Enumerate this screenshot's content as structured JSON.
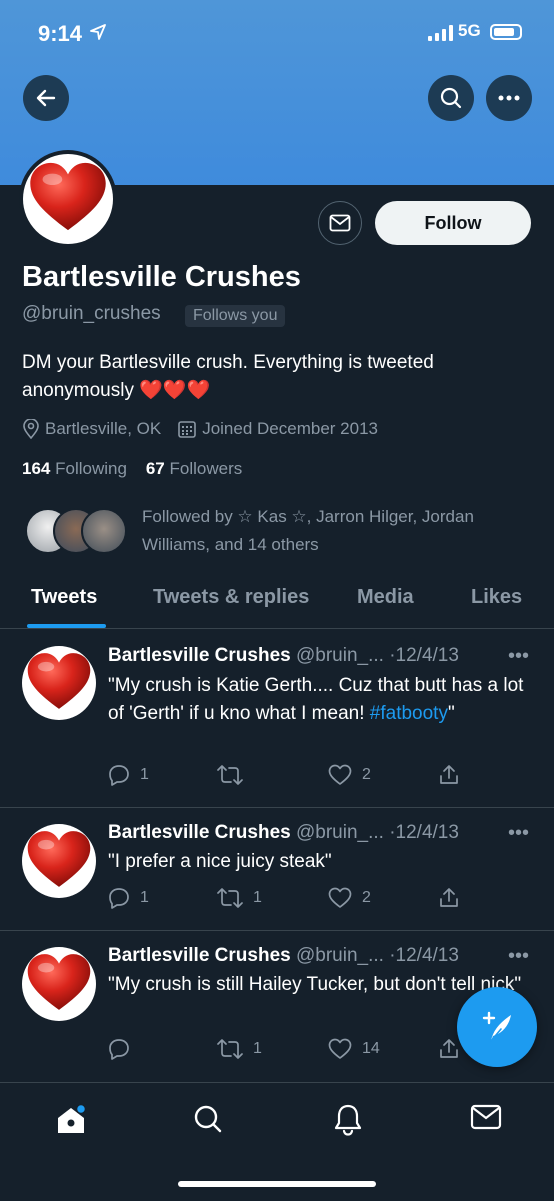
{
  "status": {
    "time": "9:14",
    "network": "5G"
  },
  "profile": {
    "name": "Bartlesville Crushes",
    "handle": "@bruin_crushes",
    "follows_you": "Follows you",
    "bio": "DM your Bartlesville crush. Everything is tweeted anonymously ❤️❤️❤️",
    "location": "Bartlesville, OK",
    "joined": "Joined December 2013",
    "following_count": "164",
    "following_label": "Following",
    "followers_count": "67",
    "followers_label": "Followers",
    "followed_by": "Followed by ☆ Kas ☆, Jarron Hilger, Jordan Williams, and 14 others",
    "follow_button": "Follow"
  },
  "tabs": [
    {
      "label": "Tweets",
      "active": true
    },
    {
      "label": "Tweets & replies"
    },
    {
      "label": "Media"
    },
    {
      "label": "Likes"
    }
  ],
  "tweets": [
    {
      "name": "Bartlesville Crushes",
      "handle": "@bruin_...",
      "date": "·12/4/13",
      "text": "\"My crush is Katie Gerth.... Cuz that butt has a lot of 'Gerth' if u kno what I mean!",
      "hashtag": "#fatbooty",
      "text_end": "\"",
      "replies": "1",
      "retweets": "",
      "likes": "2"
    },
    {
      "name": "Bartlesville Crushes",
      "handle": "@bruin_...",
      "date": "·12/4/13",
      "text": "\"I prefer a nice juicy steak\"",
      "replies": "1",
      "retweets": "1",
      "likes": "2"
    },
    {
      "name": "Bartlesville Crushes",
      "handle": "@bruin_...",
      "date": "·12/4/13",
      "text": "\"My crush is still Hailey Tucker, but don't tell nick\"",
      "replies": "",
      "retweets": "1",
      "likes": "14"
    }
  ],
  "more_glyph": "•••",
  "icons": {
    "back": "arrow-left-icon",
    "search": "search-icon",
    "more": "more-icon",
    "message": "envelope-icon",
    "compose": "compose-icon",
    "home": "home-icon",
    "notifications": "bell-icon"
  },
  "colors": {
    "accent": "#1d9bf0",
    "background": "#15202b",
    "banner": "#4f96d8"
  }
}
